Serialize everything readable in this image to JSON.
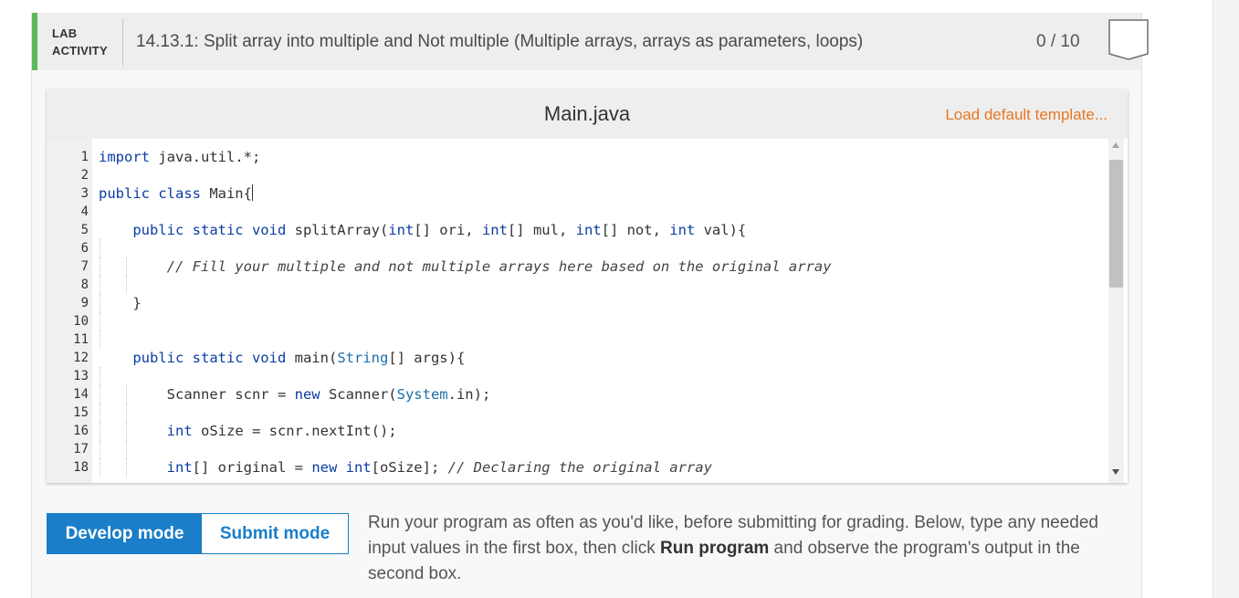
{
  "activity": {
    "label_line1": "LAB",
    "label_line2": "ACTIVITY",
    "title": "14.13.1: Split array into multiple and Not multiple (Multiple arrays, arrays as parameters, loops)",
    "score": "0 / 10"
  },
  "editor": {
    "filename": "Main.java",
    "load_template_label": "Load default template...",
    "line_numbers": [
      "1",
      "2",
      "3",
      "4",
      "5",
      "6",
      "7",
      "8",
      "9",
      "10",
      "11",
      "12",
      "13",
      "14",
      "15",
      "16",
      "17",
      "18"
    ]
  },
  "modes": {
    "develop_label": "Develop mode",
    "submit_label": "Submit mode"
  },
  "instructions": {
    "part1": "Run your program as often as you'd like, before submitting for grading. Below, type any needed input values in the first box, then click ",
    "bold": "Run program",
    "part2": " and observe the program's output in the second box."
  },
  "colors": {
    "accent_green": "#5cb85c",
    "primary_blue": "#1a7ec8",
    "link_orange": "#e87722"
  },
  "icons": [
    "shield-badge-icon",
    "scroll-up-icon",
    "scroll-down-icon"
  ]
}
